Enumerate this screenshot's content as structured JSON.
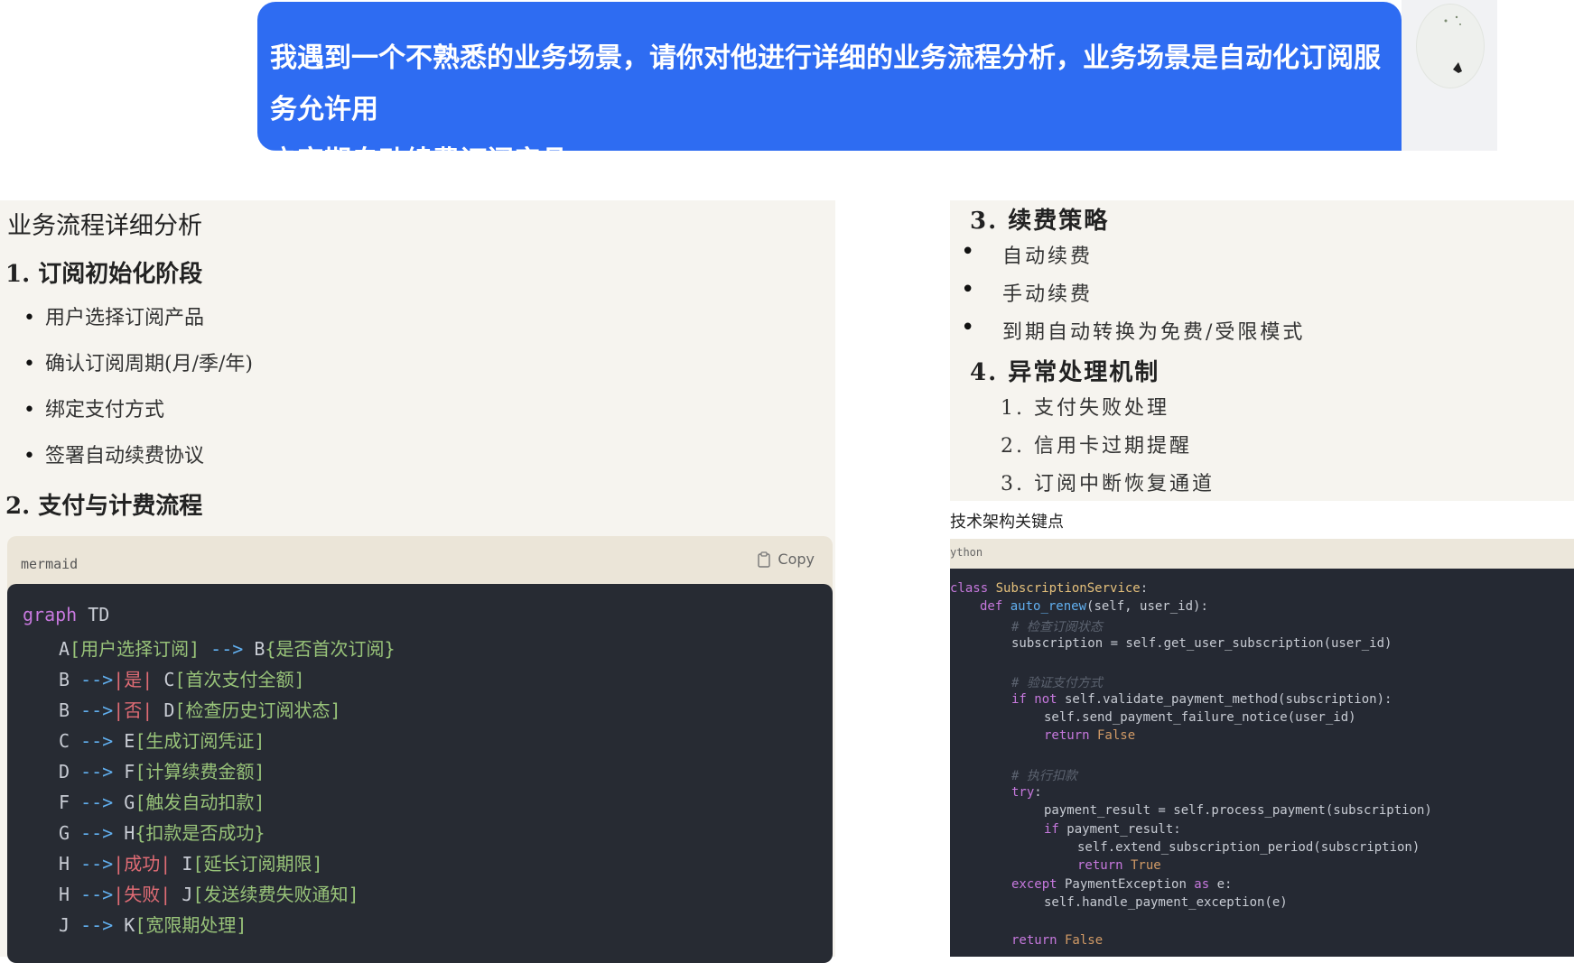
{
  "user_message": {
    "line1": "我遇到一个不熟悉的业务场景，请你对他进行详细的业务流程分析，业务场景是自动化订阅服务允许用",
    "line2": "户定期自动续费订阅产品"
  },
  "left": {
    "title": "业务流程详细分析",
    "section1": {
      "title": "1. 订阅初始化阶段",
      "items": [
        "用户选择订阅产品",
        "确认订阅周期(月/季/年)",
        "绑定支付方式",
        "签署自动续费协议"
      ]
    },
    "section2": {
      "title": "2. 支付与计费流程"
    },
    "code": {
      "lang": "mermaid",
      "copy_label": "Copy",
      "header": {
        "kw": "graph",
        "dir": " TD"
      },
      "lines": [
        {
          "src": "A",
          "src_node": "[用户选择订阅]",
          "arrow": " --> ",
          "label": "",
          "dst": "B",
          "dst_node": "{是否首次订阅}"
        },
        {
          "src": "B",
          "src_node": "",
          "arrow": " -->",
          "label": "|是|",
          "dst": " C",
          "dst_node": "[首次支付全额]"
        },
        {
          "src": "B",
          "src_node": "",
          "arrow": " -->",
          "label": "|否|",
          "dst": " D",
          "dst_node": "[检查历史订阅状态]"
        },
        {
          "src": "C",
          "src_node": "",
          "arrow": " --> ",
          "label": "",
          "dst": "E",
          "dst_node": "[生成订阅凭证]"
        },
        {
          "src": "D",
          "src_node": "",
          "arrow": " --> ",
          "label": "",
          "dst": "F",
          "dst_node": "[计算续费金额]"
        },
        {
          "src": "F",
          "src_node": "",
          "arrow": " --> ",
          "label": "",
          "dst": "G",
          "dst_node": "[触发自动扣款]"
        },
        {
          "src": "G",
          "src_node": "",
          "arrow": " --> ",
          "label": "",
          "dst": "H",
          "dst_node": "{扣款是否成功}"
        },
        {
          "src": "H",
          "src_node": "",
          "arrow": " -->",
          "label": "|成功|",
          "dst": " I",
          "dst_node": "[延长订阅期限]"
        },
        {
          "src": "H",
          "src_node": "",
          "arrow": " -->",
          "label": "|失败|",
          "dst": " J",
          "dst_node": "[发送续费失败通知]"
        },
        {
          "src": "J",
          "src_node": "",
          "arrow": " --> ",
          "label": "",
          "dst": "K",
          "dst_node": "[宽限期处理]"
        }
      ]
    }
  },
  "right": {
    "section3": {
      "title": "3. 续费策略",
      "items": [
        "自动续费",
        "手动续费",
        "到期自动转换为免费/受限模式"
      ]
    },
    "section4": {
      "title": "4. 异常处理机制",
      "items": [
        "1. 支付失败处理",
        "2. 信用卡过期提醒",
        "3. 订阅中断恢复通道"
      ]
    },
    "tech_title": "技术架构关键点",
    "code_lang": "ython",
    "code": {
      "l1_kw": "class",
      "l1_cls": " SubscriptionService",
      "l1_end": ":",
      "l2_kw": "def",
      "l2_fn": " auto_renew",
      "l2_rest": "(self, user_id):",
      "l3": "# 检查订阅状态",
      "l4": "subscription = self.get_user_subscription(user_id)",
      "l5": "# 验证支付方式",
      "l6_kw": "if not",
      "l6_rest": " self.validate_payment_method(subscription):",
      "l7": "self.send_payment_failure_notice(user_id)",
      "l8_kw": "return",
      "l8_val": " False",
      "l9": "# 执行扣款",
      "l10_kw": "try",
      "l10_rest": ":",
      "l11": "payment_result = self.process_payment(subscription)",
      "l12_kw": "if",
      "l12_rest": " payment_result:",
      "l13": "self.extend_subscription_period(subscription)",
      "l14_kw": "return",
      "l14_val": " True",
      "l15_kw": "except",
      "l15_rest": " PaymentException ",
      "l15_kw2": "as",
      "l15_rest2": " e:",
      "l16": "self.handle_payment_exception(e)",
      "l17_kw": "return",
      "l17_val": " False"
    }
  },
  "colors": {
    "bubble": "#2e6cf2",
    "panel_bg": "#f6f4ef",
    "code_bg": "#272b33"
  }
}
